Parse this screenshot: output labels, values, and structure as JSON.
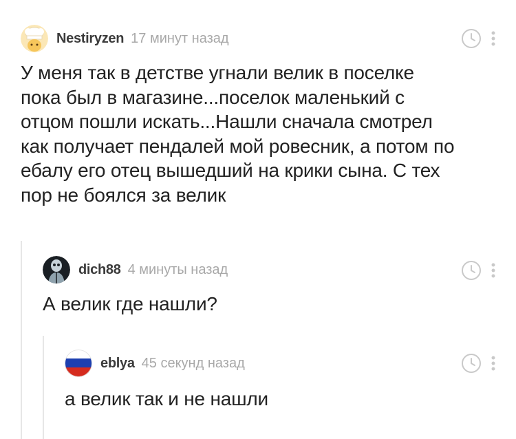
{
  "colors": {
    "author": "#3b3b3b",
    "time": "#a8a8a8",
    "text": "#222222",
    "thread_line": "#e6e6e6",
    "icon": "#c9c9c9"
  },
  "comments": [
    {
      "author": "Nestiryzen",
      "time": "17 минут назад",
      "avatar_icon": "chef-avatar-icon",
      "lines": [
        "У меня так в детстве угнали велик в поселке",
        "пока был в магазине...поселок маленький с",
        "отцом пошли искать...Нашли сначала смотрел",
        "как получает пендалей мой ровесник, а потом по",
        "ебалу его отец вышедший на крики сына. С тех",
        "пор не боялся за велик"
      ]
    },
    {
      "author": "dich88",
      "time": "4 минуты назад",
      "avatar_icon": "skull-avatar-icon",
      "lines": [
        "А велик где нашли?"
      ]
    },
    {
      "author": "eblya",
      "time": "45 секунд назад",
      "avatar_icon": "russia-flag-avatar-icon",
      "lines": [
        "а велик так и не нашли"
      ]
    }
  ]
}
